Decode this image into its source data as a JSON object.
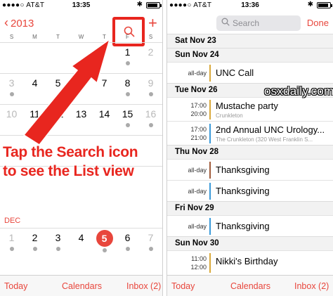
{
  "left": {
    "status": {
      "carrier": "●●●●○ AT&T",
      "time": "13:35",
      "bluetooth": "✱"
    },
    "nav": {
      "back_label": "2013",
      "plus": "+"
    },
    "weekdays": [
      "S",
      "M",
      "T",
      "W",
      "T",
      "F",
      "S"
    ],
    "rows": [
      {
        "cells": [
          "",
          "",
          "",
          "",
          "",
          "1",
          "2"
        ],
        "dots": [
          false,
          false,
          false,
          false,
          false,
          true,
          false
        ]
      },
      {
        "cells": [
          "3",
          "4",
          "5",
          "6",
          "7",
          "8",
          "9"
        ],
        "dots": [
          true,
          false,
          false,
          false,
          false,
          true,
          true
        ]
      },
      {
        "cells": [
          "10",
          "11",
          "12",
          "13",
          "14",
          "15",
          "16"
        ],
        "dots": [
          false,
          false,
          false,
          false,
          false,
          true,
          true
        ]
      },
      {
        "cells": [
          "",
          "",
          "",
          "",
          "",
          "",
          ""
        ],
        "dots": [
          false,
          false,
          false,
          false,
          false,
          false,
          false
        ]
      },
      {
        "cells": [
          "",
          "",
          "",
          "",
          "",
          "",
          ""
        ],
        "dots": [
          false,
          false,
          false,
          false,
          false,
          false,
          false
        ]
      }
    ],
    "month_label": "DEC",
    "dec_row": {
      "cells": [
        "1",
        "2",
        "3",
        "4",
        "5",
        "6",
        "7"
      ],
      "dots": [
        true,
        true,
        true,
        false,
        true,
        true,
        true
      ],
      "selected": 4
    },
    "callout_line1": "Tap the Search icon",
    "callout_line2": "to see the List view",
    "toolbar": {
      "today": "Today",
      "calendars": "Calendars",
      "inbox": "Inbox (2)"
    }
  },
  "right": {
    "status": {
      "carrier": "●●●●○ AT&T",
      "time": "13:36",
      "bluetooth": "✱"
    },
    "search_placeholder": "Search",
    "done_label": "Done",
    "watermark": "osxdaily.com",
    "days": [
      {
        "header": "Sat  Nov 23",
        "events": []
      },
      {
        "header": "Sun  Nov 24",
        "events": [
          {
            "time": "all-day",
            "title": "UNC Call",
            "sub": "",
            "color": "#d9a93a"
          }
        ]
      },
      {
        "header": "Tue  Nov 26",
        "events": [
          {
            "time": "17:00",
            "time2": "20:00",
            "title": "Mustache party",
            "sub": "Crunkleton",
            "color": "#d9a93a"
          },
          {
            "time": "17:00",
            "time2": "21:00",
            "title": "2nd Annual UNC Urology...",
            "sub": "The Crunkleton (320 West Franklin S...",
            "color": "#3a9ad9"
          }
        ]
      },
      {
        "header": "Thu  Nov 28",
        "events": [
          {
            "time": "all-day",
            "title": "Thanksgiving",
            "sub": "",
            "color": "#a05a3a"
          },
          {
            "time": "all-day",
            "title": "Thanksgiving",
            "sub": "",
            "color": "#3a9ad9"
          }
        ]
      },
      {
        "header": "Fri  Nov 29",
        "events": [
          {
            "time": "all-day",
            "title": "Thanksgiving",
            "sub": "",
            "color": "#3a9ad9"
          }
        ]
      },
      {
        "header": "Sun  Nov 30",
        "events": [
          {
            "time": "11:00",
            "time2": "12:00",
            "title": "Nikki's Birthday",
            "sub": "",
            "color": "#d9a93a"
          }
        ]
      }
    ],
    "toolbar": {
      "today": "Today",
      "calendars": "Calendars",
      "inbox": "Inbox (2)"
    }
  },
  "colors": {
    "accent": "#e8463c",
    "annotation": "#e8261f"
  }
}
